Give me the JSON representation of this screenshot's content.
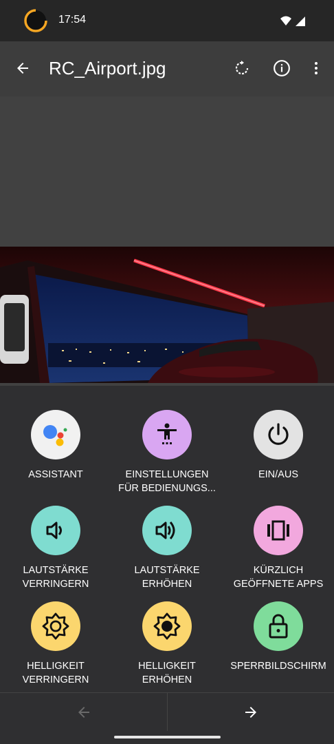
{
  "status_bar": {
    "time": "17:54"
  },
  "app_bar": {
    "title": "RC_Airport.jpg",
    "back_icon": "arrow-left-icon",
    "rotate_icon": "rotate-icon",
    "info_icon": "info-icon",
    "more_icon": "more-vert-icon"
  },
  "actions": [
    {
      "id": "assistant",
      "label_lines": [
        "ASSISTANT"
      ],
      "color": "#f1f1f1",
      "icon": "google-assistant-icon"
    },
    {
      "id": "accessibility",
      "label_lines": [
        "EINSTELLUNGEN",
        "FÜR BEDIENUNGS..."
      ],
      "color": "#d9a6f2",
      "icon": "accessibility-icon"
    },
    {
      "id": "power",
      "label_lines": [
        "EIN/AUS"
      ],
      "color": "#e3e3e3",
      "icon": "power-icon"
    },
    {
      "id": "volume-down",
      "label_lines": [
        "LAUTSTÄRKE",
        "VERRINGERN"
      ],
      "color": "#7fdcd0",
      "icon": "volume-down-icon"
    },
    {
      "id": "volume-up",
      "label_lines": [
        "LAUTSTÄRKE",
        "ERHÖHEN"
      ],
      "color": "#7fdcd0",
      "icon": "volume-up-icon"
    },
    {
      "id": "recent-apps",
      "label_lines": [
        "KÜRZLICH",
        "GEÖFFNETE APPS"
      ],
      "color": "#f2a8de",
      "icon": "recent-apps-icon"
    },
    {
      "id": "brightness-down",
      "label_lines": [
        "HELLIGKEIT",
        "VERRINGERN"
      ],
      "color": "#fbd66e",
      "icon": "brightness-low-icon"
    },
    {
      "id": "brightness-up",
      "label_lines": [
        "HELLIGKEIT",
        "ERHÖHEN"
      ],
      "color": "#fbd66e",
      "icon": "brightness-high-icon"
    },
    {
      "id": "lock-screen",
      "label_lines": [
        "SPERRBILDSCHIRM"
      ],
      "color": "#7fdc9b",
      "icon": "lock-icon"
    }
  ],
  "nav": {
    "prev_icon": "arrow-left-icon",
    "next_icon": "arrow-right-icon"
  }
}
